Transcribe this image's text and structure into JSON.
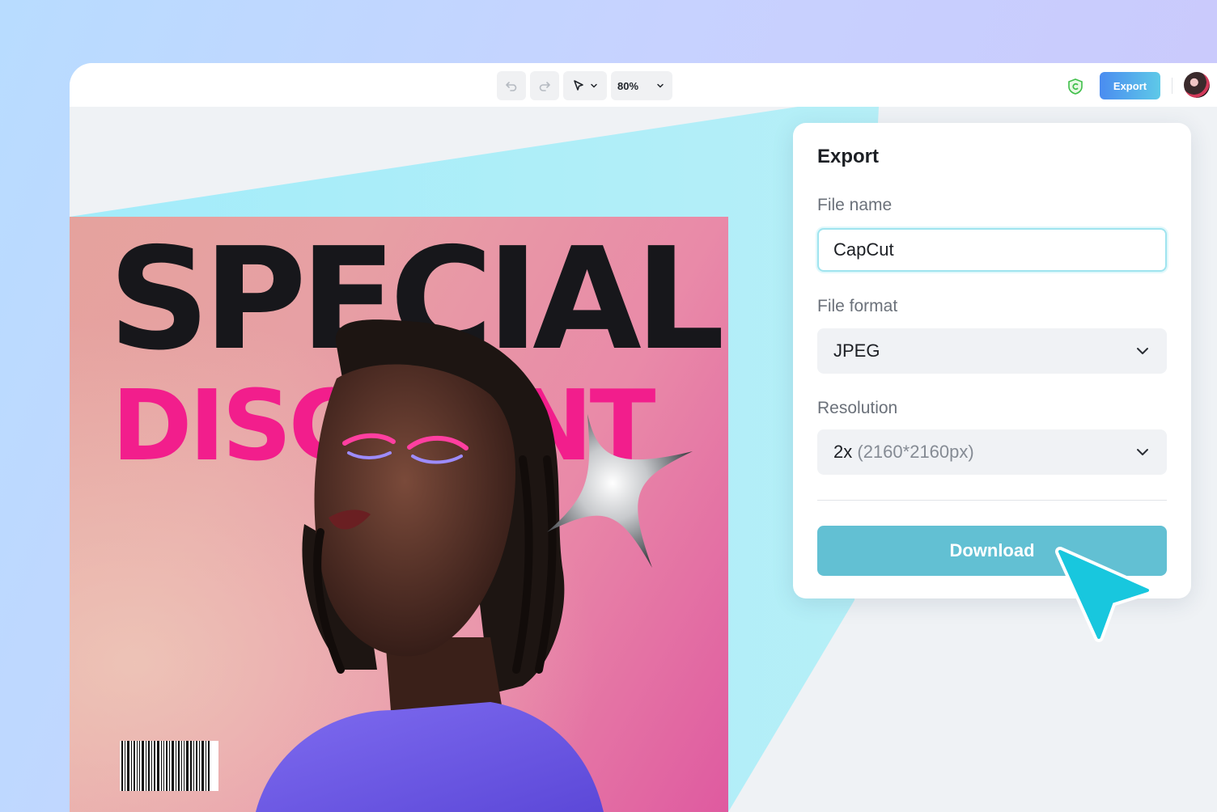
{
  "toolbar": {
    "zoom": "80%",
    "export_label": "Export",
    "icons": [
      "undo-icon",
      "redo-icon",
      "pointer-icon",
      "chevron-down-icon",
      "shield-icon",
      "avatar"
    ]
  },
  "design": {
    "headline": "SPECIAL",
    "subline": "DISCOUNT"
  },
  "export_panel": {
    "title": "Export",
    "file_name_label": "File name",
    "file_name_value": "CapCut",
    "file_format_label": "File format",
    "file_format_value": "JPEG",
    "resolution_label": "Resolution",
    "resolution_value": "2x",
    "resolution_detail": "(2160*2160px)",
    "download_label": "Download"
  },
  "colors": {
    "accent": "#62c0d3",
    "export_gradient_start": "#4a8cf0",
    "headline_color": "#17171b",
    "subline_color": "#f21e8c",
    "cursor_color": "#18c7de"
  }
}
